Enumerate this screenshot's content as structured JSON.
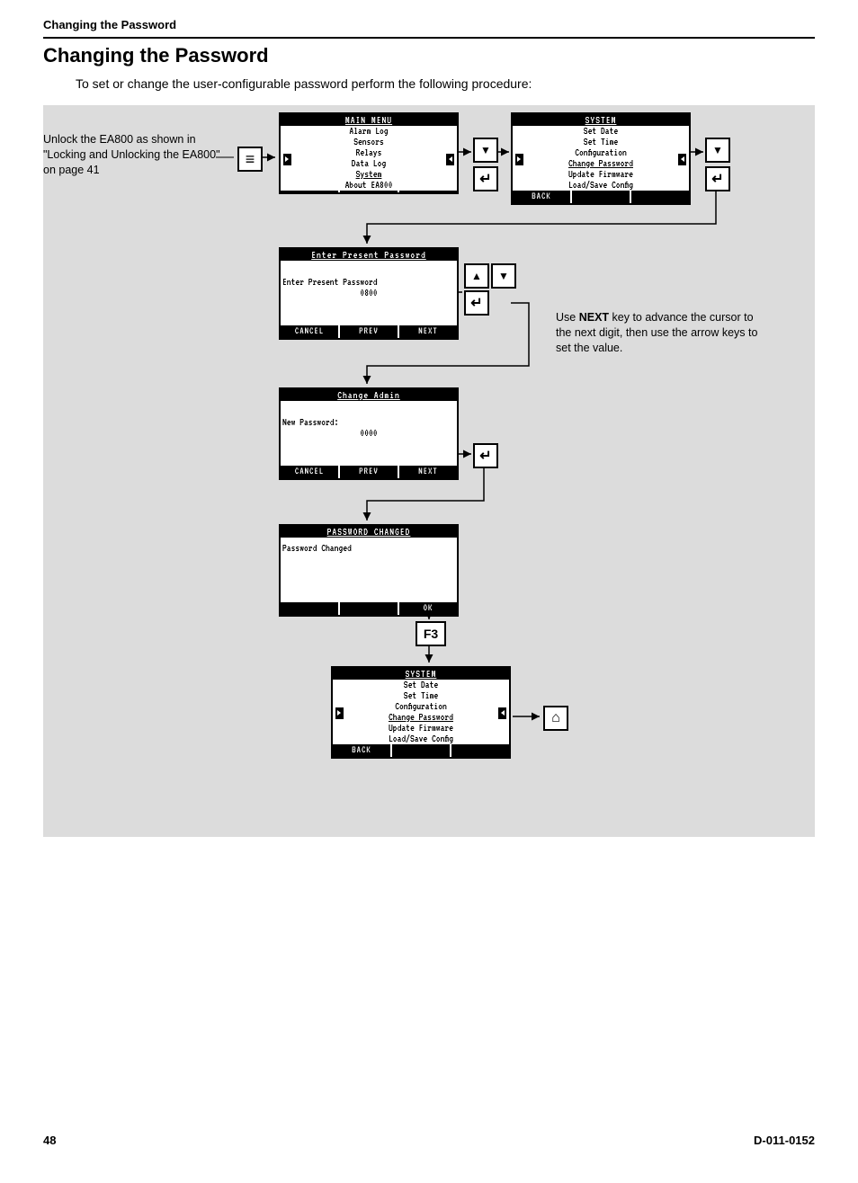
{
  "header": {
    "running": "Changing the Password",
    "title": "Changing the Password",
    "intro": "To set or change the user-configurable password perform the following procedure:"
  },
  "callouts": {
    "unlock": "Unlock the EA800 as shown in \"Locking and Unlocking the EA800\" on page 41",
    "next_a": "Use ",
    "next_b": "NEXT",
    "next_c": " key to advance the cursor to the next digit, then use the arrow keys to set the value."
  },
  "keys": {
    "f3": "F3"
  },
  "screens": {
    "main": {
      "title": "MAIN MENU",
      "l1": "Alarm Log",
      "l2": "Sensors",
      "l3": "Relays",
      "l4": "Data Log",
      "l5": "System",
      "l6": "About EA800",
      "sk1": "",
      "sk2": "",
      "sk3": ""
    },
    "system": {
      "title": "SYSTEM",
      "l1": "Set Date",
      "l2": "Set Time",
      "l3": "Configuration",
      "l4": "Change Password",
      "l5": "Update Firmware",
      "l6": "Load/Save Config",
      "sk1": "BACK",
      "sk2": "",
      "sk3": ""
    },
    "present": {
      "title": "Enter Present Password",
      "l1": "Enter Present Password",
      "l2": "0800",
      "sk1": "CANCEL",
      "sk2": "PREV",
      "sk3": "NEXT"
    },
    "change": {
      "title": "Change Admin",
      "l1": "New Password:",
      "l2": "0000",
      "sk1": "CANCEL",
      "sk2": "PREV",
      "sk3": "NEXT"
    },
    "done": {
      "title": "PASSWORD CHANGED",
      "l1": "Password Changed",
      "sk1": "",
      "sk2": "",
      "sk3": "OK"
    },
    "system2": {
      "title": "SYSTEM",
      "l1": "Set Date",
      "l2": "Set Time",
      "l3": "Configuration",
      "l4": "Change Password",
      "l5": "Update Firmware",
      "l6": "Load/Save Config",
      "sk1": "BACK",
      "sk2": "",
      "sk3": ""
    }
  },
  "footer": {
    "page": "48",
    "doc": "D-011-0152"
  }
}
